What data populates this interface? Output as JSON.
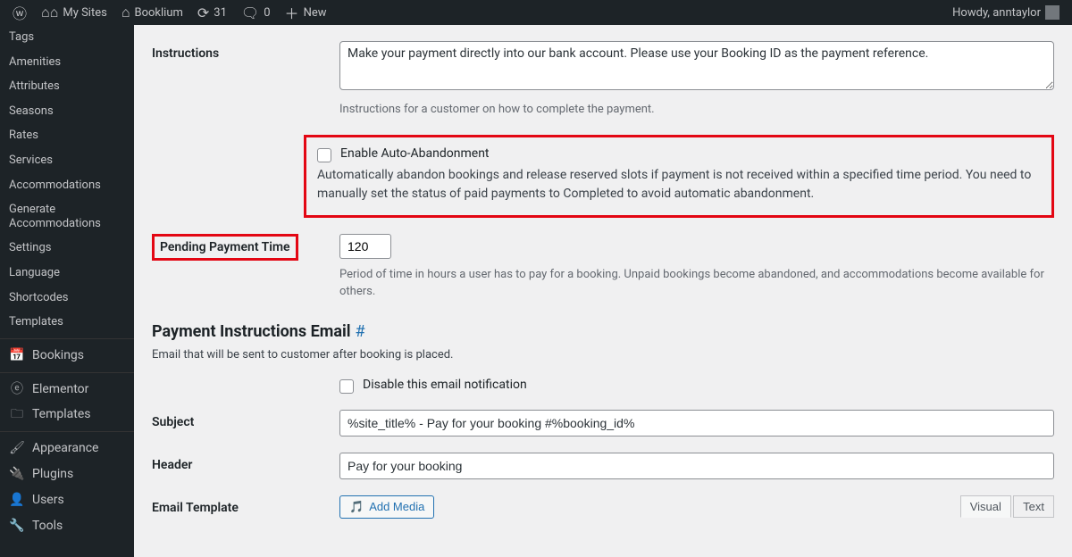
{
  "adminbar": {
    "my_sites": "My Sites",
    "site_name": "Booklium",
    "updates_count": "31",
    "comments_count": "0",
    "new_label": "New",
    "howdy": "Howdy, anntaylor"
  },
  "sidebar": {
    "sub_items": [
      "Tags",
      "Amenities",
      "Attributes",
      "Seasons",
      "Rates",
      "Services",
      "Accommodations",
      "Generate Accommodations",
      "Settings",
      "Language",
      "Shortcodes",
      "Templates"
    ],
    "bookings": "Bookings",
    "elementor": "Elementor",
    "templates": "Templates",
    "appearance": "Appearance",
    "plugins": "Plugins",
    "users": "Users",
    "tools": "Tools"
  },
  "instructions": {
    "label": "Instructions",
    "value": "Make your payment directly into our bank account. Please use your Booking ID as the payment reference.",
    "help": "Instructions for a customer on how to complete the payment."
  },
  "auto_abandon": {
    "checkbox_label": "Enable Auto-Abandonment",
    "desc": "Automatically abandon bookings and release reserved slots if payment is not received within a specified time period. You need to manually set the status of paid payments to Completed to avoid automatic abandonment."
  },
  "pending_time": {
    "label": "Pending Payment Time",
    "value": "120",
    "help": "Period of time in hours a user has to pay for a booking. Unpaid bookings become abandoned, and accommodations become available for others."
  },
  "email_section": {
    "heading": "Payment Instructions Email",
    "hash": "#",
    "sub": "Email that will be sent to customer after booking is placed.",
    "disable_label": "Disable this email notification"
  },
  "subject": {
    "label": "Subject",
    "value": "%site_title% - Pay for your booking #%booking_id%"
  },
  "header": {
    "label": "Header",
    "value": "Pay for your booking"
  },
  "template": {
    "label": "Email Template",
    "add_media": "Add Media",
    "tab_visual": "Visual",
    "tab_text": "Text"
  }
}
